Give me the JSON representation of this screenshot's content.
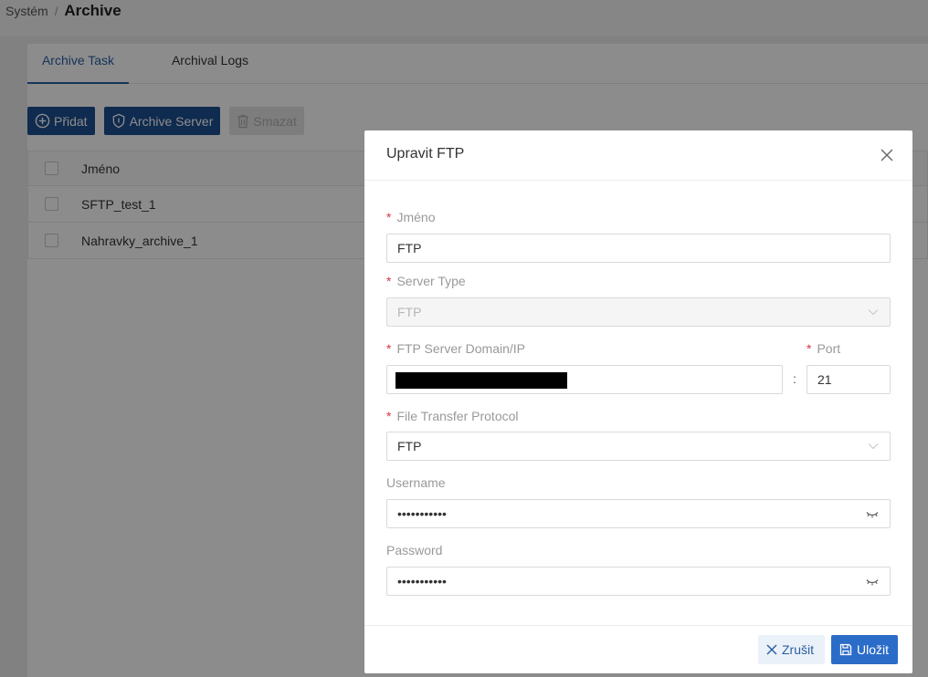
{
  "breadcrumb": {
    "parent": "Systém",
    "separator": "/",
    "current": "Archive"
  },
  "tabs": [
    {
      "label": "Archive Task",
      "active": true
    },
    {
      "label": "Archival Logs",
      "active": false
    }
  ],
  "toolbar": {
    "add_label": "Přidat",
    "archive_server_label": "Archive Server",
    "delete_label": "Smazat"
  },
  "table": {
    "columns": [
      "Jméno"
    ],
    "rows": [
      {
        "name": "SFTP_test_1"
      },
      {
        "name": "Nahravky_archive_1"
      }
    ]
  },
  "modal": {
    "title": "Upravit FTP",
    "fields": {
      "name": {
        "label": "Jméno",
        "value": "FTP",
        "required": true
      },
      "server_type": {
        "label": "Server Type",
        "value": "FTP",
        "required": true,
        "disabled": true
      },
      "domain": {
        "label": "FTP Server Domain/IP",
        "value": "",
        "required": true,
        "redacted": true
      },
      "port_separator": ":",
      "port": {
        "label": "Port",
        "value": "21",
        "required": true
      },
      "protocol": {
        "label": "File Transfer Protocol",
        "value": "FTP",
        "required": true
      },
      "username": {
        "label": "Username",
        "value": "•••••••••••"
      },
      "password": {
        "label": "Password",
        "value": "•••••••••••"
      }
    },
    "required_marker": "*",
    "cancel_label": "Zrušit",
    "save_label": "Uložit"
  },
  "colors": {
    "primary": "#1d4f91",
    "save": "#2b6cc8",
    "accent_text": "#2b5fa5",
    "required": "#d9363e"
  }
}
